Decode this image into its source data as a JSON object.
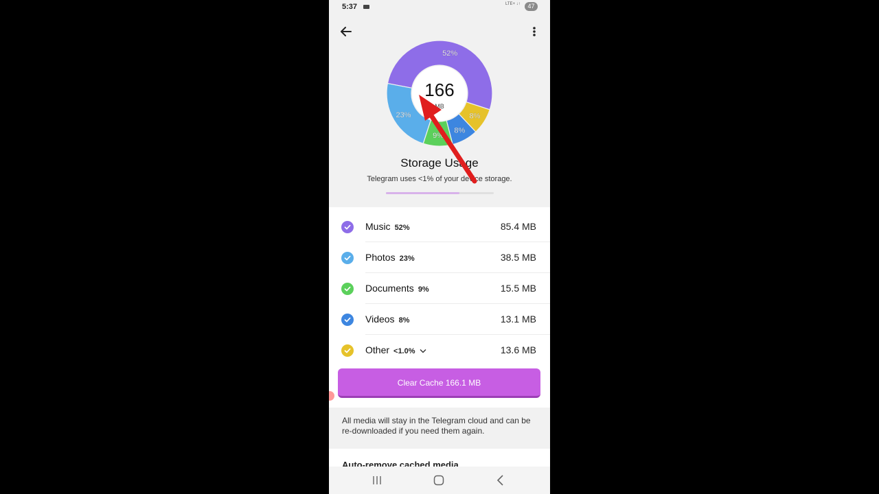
{
  "status_bar": {
    "time": "5:37",
    "signal": "LTE+ ↓↑",
    "battery": "47"
  },
  "header": {
    "back_icon": "arrow-left-icon",
    "menu_icon": "more-vertical-icon"
  },
  "chart_data": {
    "type": "pie",
    "center_value": "166",
    "center_unit": "MB",
    "slices": [
      {
        "label": "Music",
        "percent_label": "52%",
        "value": 52,
        "color": "#8e6de8"
      },
      {
        "label": "Other",
        "percent_label": "8%",
        "value": 8,
        "color": "#e6c22a"
      },
      {
        "label": "Videos",
        "percent_label": "8%",
        "value": 8,
        "color": "#3d86e0"
      },
      {
        "label": "Documents",
        "percent_label": "9%",
        "value": 9,
        "color": "#5bd05b"
      },
      {
        "label": "Photos",
        "percent_label": "23%",
        "value": 23,
        "color": "#5aaeea"
      }
    ]
  },
  "title": "Storage Usage",
  "subtitle": "Telegram uses <1% of your device storage.",
  "usage_fraction": 0.68,
  "categories": [
    {
      "name": "Music",
      "percent": "52%",
      "size": "85.4 MB",
      "color": "#8e6de8"
    },
    {
      "name": "Photos",
      "percent": "23%",
      "size": "38.5 MB",
      "color": "#5aaeea"
    },
    {
      "name": "Documents",
      "percent": "9%",
      "size": "15.5 MB",
      "color": "#5bd05b"
    },
    {
      "name": "Videos",
      "percent": "8%",
      "size": "13.1 MB",
      "color": "#3d86e0"
    },
    {
      "name": "Other",
      "percent": "<1.0%",
      "size": "13.6 MB",
      "color": "#e6c22a"
    }
  ],
  "clear_button": "Clear Cache  166.1 MB",
  "note": "All media will stay in the Telegram cloud and can be re-downloaded if you need them again.",
  "next_section_title": "Auto-remove cached media",
  "nav": {
    "recents_icon": "recents-icon",
    "home_icon": "home-icon",
    "back_icon": "back-chevron-icon"
  }
}
